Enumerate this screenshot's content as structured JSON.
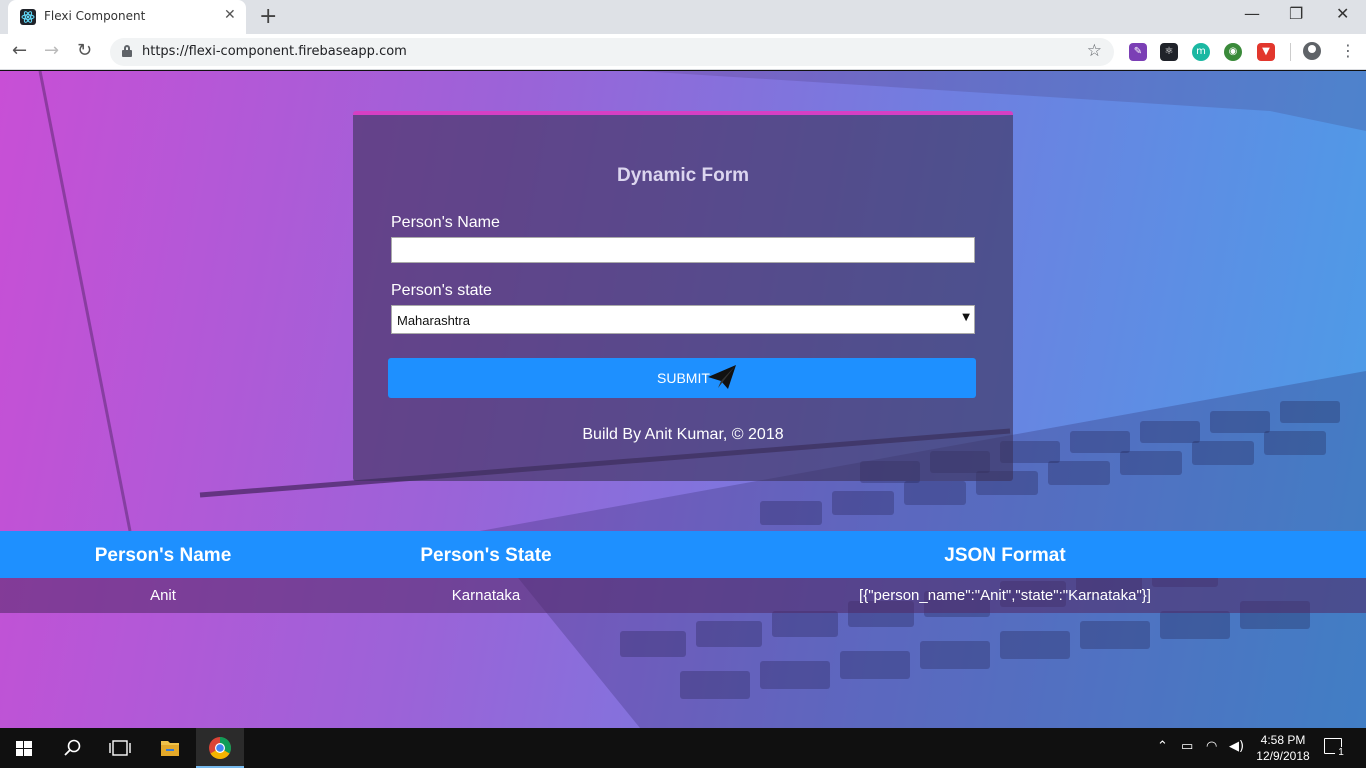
{
  "browser": {
    "tab_title": "Flexi Component",
    "tab_close": "✕",
    "new_tab": "+",
    "url": "https://flexi-component.firebaseapp.com",
    "window_controls": {
      "minimize": "—",
      "maximize": "❐",
      "close": "✕"
    },
    "nav": {
      "back": "←",
      "forward": "→",
      "reload": "↻"
    },
    "bookmark_star": "☆",
    "menu": "⋮",
    "extensions": [
      {
        "name": "eyedropper-extension-icon",
        "color": "#7b3fb5",
        "glyph": "✎"
      },
      {
        "name": "react-devtools-extension-icon",
        "color": "#20232a",
        "glyph": "⚛"
      },
      {
        "name": "m-extension-icon",
        "color": "#1bb8a2",
        "glyph": "m"
      },
      {
        "name": "globe-extension-icon",
        "color": "#3a8a3a",
        "glyph": "◉"
      },
      {
        "name": "brave-shield-extension-icon",
        "color": "#e2372d",
        "glyph": "▼"
      }
    ]
  },
  "form": {
    "title": "Dynamic Form",
    "name_label": "Person's Name",
    "name_value": "",
    "state_label": "Person's state",
    "state_selected": "Maharashtra",
    "submit_label": "SUBMIT",
    "footer": "Build By Anit Kumar, © 2018"
  },
  "table": {
    "headers": [
      "Person's Name",
      "Person's State",
      "JSON Format"
    ],
    "rows": [
      [
        "Anit",
        "Karnataka",
        "[{\"person_name\":\"Anit\",\"state\":\"Karnataka\"}]"
      ]
    ]
  },
  "taskbar": {
    "time": "4:58 PM",
    "date": "12/9/2018",
    "notification_count": "1"
  },
  "colors": {
    "accent": "#1e90ff",
    "card_top_border": "#d63fc4"
  }
}
